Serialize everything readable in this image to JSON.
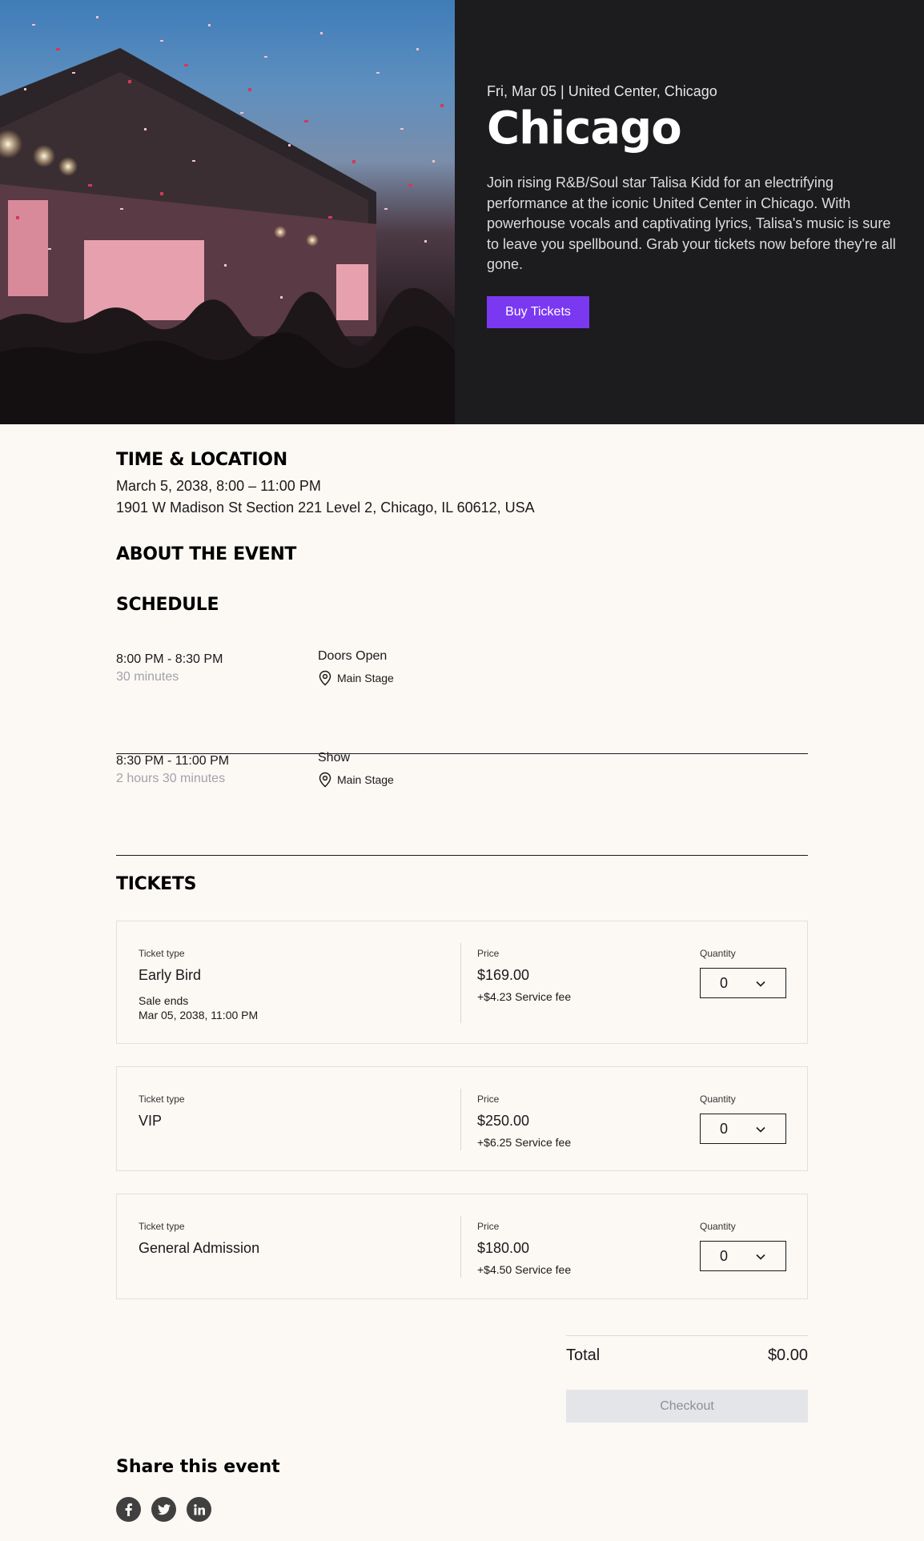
{
  "hero": {
    "image_alt": "concert-crowd-confetti",
    "subtitle": "Fri, Mar 05 | United Center, Chicago",
    "title": "Chicago",
    "description": "Join rising R&B/Soul star Talisa Kidd for an electrifying performance at the iconic United Center in Chicago. With powerhouse vocals and captivating lyrics, Talisa's music is sure to leave you spellbound. Grab your tickets now before they're all gone.",
    "buy_button": "Buy Tickets",
    "accent_color": "#7a38f1"
  },
  "time_location": {
    "heading": "TIME & LOCATION",
    "date": "March 5, 2038, 8:00 – 11:00 PM",
    "address": "1901 W Madison St Section 221 Level 2, Chicago, IL 60612, USA"
  },
  "about": {
    "heading": "ABOUT THE EVENT"
  },
  "schedule": {
    "heading": "SCHEDULE",
    "items": [
      {
        "time": "8:00 PM - 8:30 PM",
        "duration": "30 minutes",
        "title": "Doors Open",
        "location": "Main Stage"
      },
      {
        "time": "8:30 PM - 11:00 PM",
        "duration": "2 hours 30 minutes",
        "title": "Show",
        "location": "Main Stage"
      }
    ]
  },
  "tickets": {
    "heading": "TICKETS",
    "type_label": "Ticket type",
    "price_label": "Price",
    "quantity_label": "Quantity",
    "items": [
      {
        "name": "Early Bird",
        "sale_ends_label": "Sale ends",
        "sale_ends_date": "Mar 05, 2038, 11:00 PM",
        "price": "$169.00",
        "fee": "+$4.23 Service fee",
        "quantity": "0"
      },
      {
        "name": "VIP",
        "price": "$250.00",
        "fee": "+$6.25 Service fee",
        "quantity": "0"
      },
      {
        "name": "General Admission",
        "price": "$180.00",
        "fee": "+$4.50 Service fee",
        "quantity": "0"
      }
    ]
  },
  "checkout": {
    "total_label": "Total",
    "total_value": "$0.00",
    "button": "Checkout"
  },
  "share": {
    "heading": "Share this event",
    "icons": [
      "facebook-icon",
      "twitter-icon",
      "linkedin-icon"
    ]
  }
}
